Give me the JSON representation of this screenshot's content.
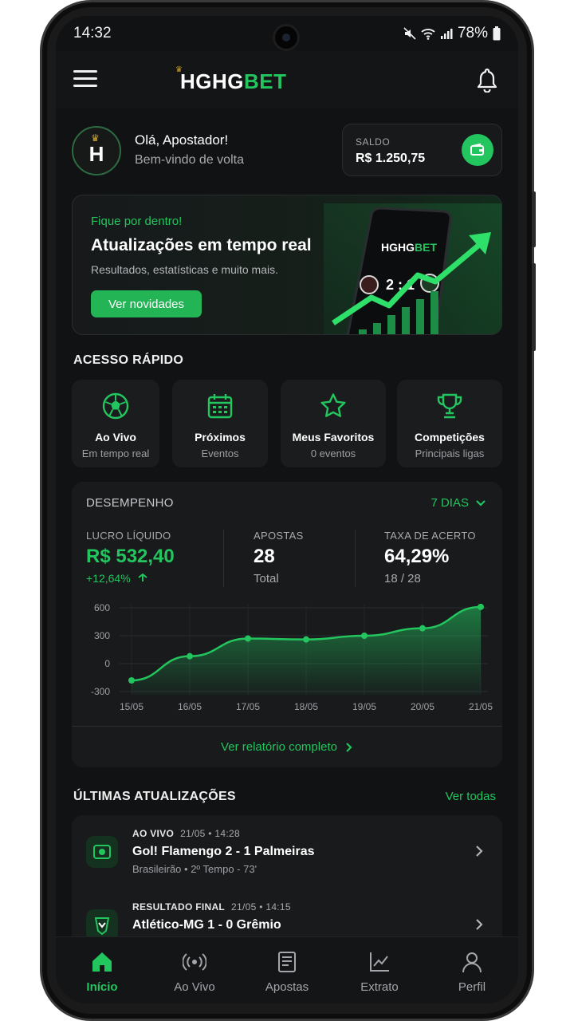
{
  "status_bar": {
    "time": "14:32",
    "battery": "78%"
  },
  "header": {
    "logo_a": "HGHG",
    "logo_b": "BET"
  },
  "greeting": {
    "avatar_letter": "H",
    "title": "Olá, Apostador!",
    "subtitle": "Bem-vindo de volta"
  },
  "balance": {
    "label": "SALDO",
    "value": "R$ 1.250,75"
  },
  "promo": {
    "kicker": "Fique por dentro!",
    "title": "Atualizações em tempo real",
    "subtitle": "Resultados, estatísticas e muito mais.",
    "button": "Ver novidades",
    "art_logo_a": "HGHG",
    "art_logo_b": "BET",
    "art_score": "2 : 1"
  },
  "quick_access": {
    "title": "ACESSO RÁPIDO",
    "items": [
      {
        "label": "Ao Vivo",
        "sub": "Em tempo real",
        "icon": "soccer-ball-icon"
      },
      {
        "label": "Próximos",
        "sub": "Eventos",
        "icon": "calendar-icon"
      },
      {
        "label": "Meus Favoritos",
        "sub": "0 eventos",
        "icon": "star-icon"
      },
      {
        "label": "Competições",
        "sub": "Principais ligas",
        "icon": "trophy-icon"
      }
    ]
  },
  "performance": {
    "title": "DESEMPENHO",
    "range": "7 DIAS",
    "profit_label": "LUCRO LÍQUIDO",
    "profit_value": "R$ 532,40",
    "profit_change": "+12,64%",
    "bets_label": "APOSTAS",
    "bets_value": "28",
    "bets_sub": "Total",
    "hit_label": "TAXA DE ACERTO",
    "hit_value": "64,29%",
    "hit_sub": "18 / 28",
    "footer_link": "Ver relatório completo",
    "accent": "#22c55e"
  },
  "chart_data": {
    "type": "area",
    "categories": [
      "15/05",
      "16/05",
      "17/05",
      "18/05",
      "19/05",
      "20/05",
      "21/05"
    ],
    "values": [
      -180,
      80,
      270,
      260,
      300,
      380,
      610
    ],
    "yticks": [
      "600",
      "300",
      "0",
      "-300"
    ],
    "ylim": [
      -300,
      600
    ],
    "grid": true
  },
  "updates": {
    "title": "ÚLTIMAS ATUALIZAÇÕES",
    "see_all": "Ver todas",
    "items": [
      {
        "tag": "AO VIVO",
        "time": "21/05 • 14:28",
        "title": "Gol! Flamengo 2 - 1 Palmeiras",
        "sub": "Brasileirão • 2º Tempo - 73'"
      },
      {
        "tag": "RESULTADO FINAL",
        "time": "21/05 • 14:15",
        "title": "Atlético-MG 1 - 0 Grêmio",
        "sub": ""
      }
    ]
  },
  "bottom_nav": {
    "items": [
      {
        "label": "Início",
        "active": true
      },
      {
        "label": "Ao Vivo"
      },
      {
        "label": "Apostas"
      },
      {
        "label": "Extrato"
      },
      {
        "label": "Perfil"
      }
    ]
  }
}
